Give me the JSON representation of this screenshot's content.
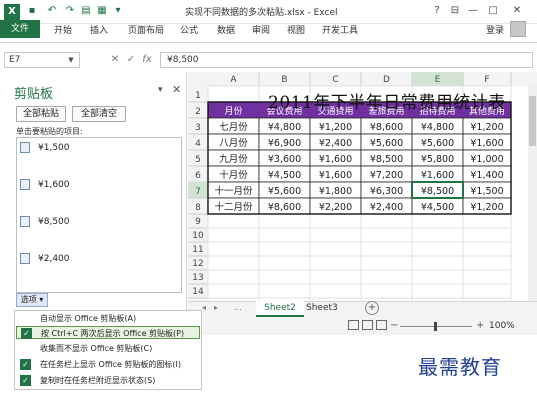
{
  "window": {
    "title": "实现不同数据的多次粘贴.xlsx - Excel",
    "controls": [
      "?",
      "⊟",
      "—",
      "□",
      "✕"
    ],
    "login_label": "登录"
  },
  "quick_access": [
    "save-icon",
    "undo-icon",
    "redo-icon",
    "open-icon",
    "print-icon",
    "dropdown-icon"
  ],
  "ribbon": {
    "file_tab": "文件",
    "tabs": [
      "开始",
      "插入",
      "页面布局",
      "公式",
      "数据",
      "审阅",
      "视图",
      "开发工具"
    ]
  },
  "formula_bar": {
    "name_box": "E7",
    "cancel_icon": "✕",
    "enter_icon": "✓",
    "fx": "fx",
    "value": "¥8,500"
  },
  "clipboard_pane": {
    "title": "剪贴板",
    "paste_all": "全部粘贴",
    "clear_all": "全部清空",
    "hint": "单击要粘贴的项目:",
    "items": [
      "¥1,500",
      "¥1,600",
      "¥8,500",
      "¥2,400"
    ],
    "options_label": "选项 ▾",
    "close_icon": "✕",
    "menu_icon": "▾"
  },
  "options_menu": [
    {
      "label": "自动显示 Office 剪贴板(A)",
      "checked": false
    },
    {
      "label": "按 Ctrl+C 两次后显示 Office 剪贴板(P)",
      "checked": true
    },
    {
      "label": "收集而不显示 Office 剪贴板(C)",
      "checked": false
    },
    {
      "label": "在任务栏上显示 Office 剪贴板的图标(I)",
      "checked": true
    },
    {
      "label": "复制时在任务栏附近显示状态(S)",
      "checked": true
    }
  ],
  "sheet": {
    "column_letters": [
      "A",
      "B",
      "C",
      "D",
      "E",
      "F"
    ],
    "row_numbers": [
      "1",
      "2",
      "3",
      "4",
      "5",
      "6",
      "7",
      "8",
      "9",
      "10",
      "11",
      "12",
      "13",
      "14",
      "15"
    ],
    "title": "2011年下半年日常费用统计表",
    "headers": [
      "月份",
      "会议费用",
      "交通费用",
      "差旅费用",
      "招待费用",
      "其他费用"
    ],
    "rows": [
      [
        "七月份",
        "¥4,800",
        "¥1,200",
        "¥8,600",
        "¥4,800",
        "¥1,200"
      ],
      [
        "八月份",
        "¥6,900",
        "¥2,400",
        "¥5,600",
        "¥5,600",
        "¥1,600"
      ],
      [
        "九月份",
        "¥3,600",
        "¥1,600",
        "¥8,500",
        "¥5,800",
        "¥1,000"
      ],
      [
        "十月份",
        "¥4,500",
        "¥1,600",
        "¥7,200",
        "¥1,600",
        "¥1,400"
      ],
      [
        "十一月份",
        "¥5,600",
        "¥1,800",
        "¥6,300",
        "¥8,500",
        "¥1,500"
      ],
      [
        "十二月份",
        "¥8,600",
        "¥2,200",
        "¥2,400",
        "¥4,500",
        "¥1,200"
      ]
    ],
    "header_color": "#7030a0"
  },
  "sheet_tabs": [
    "Sheet2",
    "Sheet3"
  ],
  "status": {
    "nav_left": "◂",
    "nav_right": "▸",
    "more": "...",
    "add_sheet": "+",
    "zoom": "100%",
    "zoom_minus": "−",
    "zoom_plus": "+"
  },
  "watermark": "最需教育"
}
